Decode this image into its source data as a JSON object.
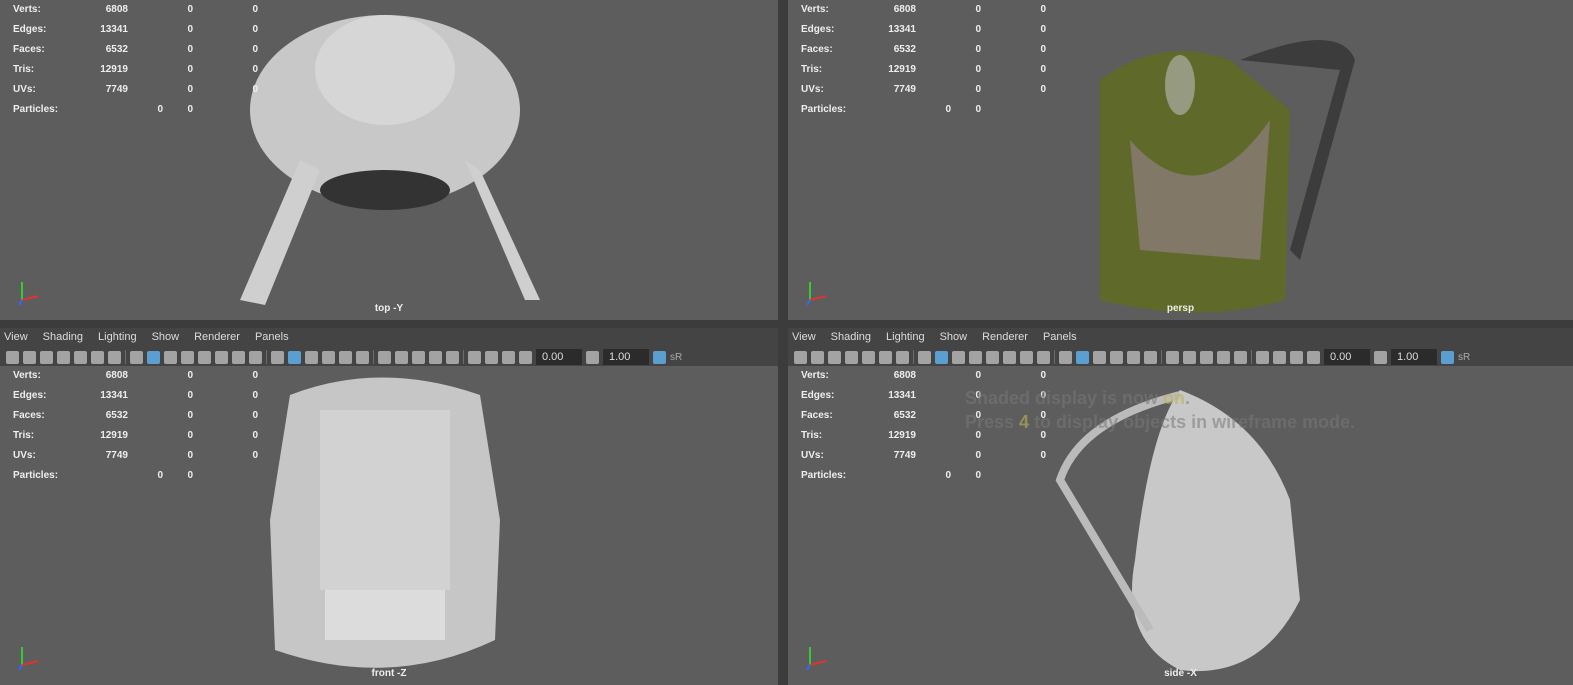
{
  "menus": [
    "View",
    "Shading",
    "Lighting",
    "Show",
    "Renderer",
    "Panels"
  ],
  "toolbar": {
    "exposure": "0.00",
    "gamma": "1.00",
    "colorspace": "sR"
  },
  "stats": [
    {
      "label": "Verts:",
      "values": [
        "6808",
        "0",
        "0"
      ]
    },
    {
      "label": "Edges:",
      "values": [
        "13341",
        "0",
        "0"
      ]
    },
    {
      "label": "Faces:",
      "values": [
        "6532",
        "0",
        "0"
      ]
    },
    {
      "label": "Tris:",
      "values": [
        "12919",
        "0",
        "0"
      ]
    },
    {
      "label": "UVs:",
      "values": [
        "7749",
        "0",
        "0"
      ]
    },
    {
      "label": "Particles:",
      "values": [
        "0",
        "0"
      ]
    }
  ],
  "viewports": [
    {
      "camera": "top -Y"
    },
    {
      "camera": "persp"
    },
    {
      "camera": "front -Z"
    },
    {
      "camera": "side -X"
    }
  ],
  "hud": {
    "line1a": "Shaded display is now ",
    "line1b": "on",
    "line1c": ".",
    "line2a": "Press ",
    "line2b": "4",
    "line2c": " to display objects in wireframe mode."
  },
  "axes": {
    "x": "x",
    "y": "y",
    "z": "z"
  }
}
